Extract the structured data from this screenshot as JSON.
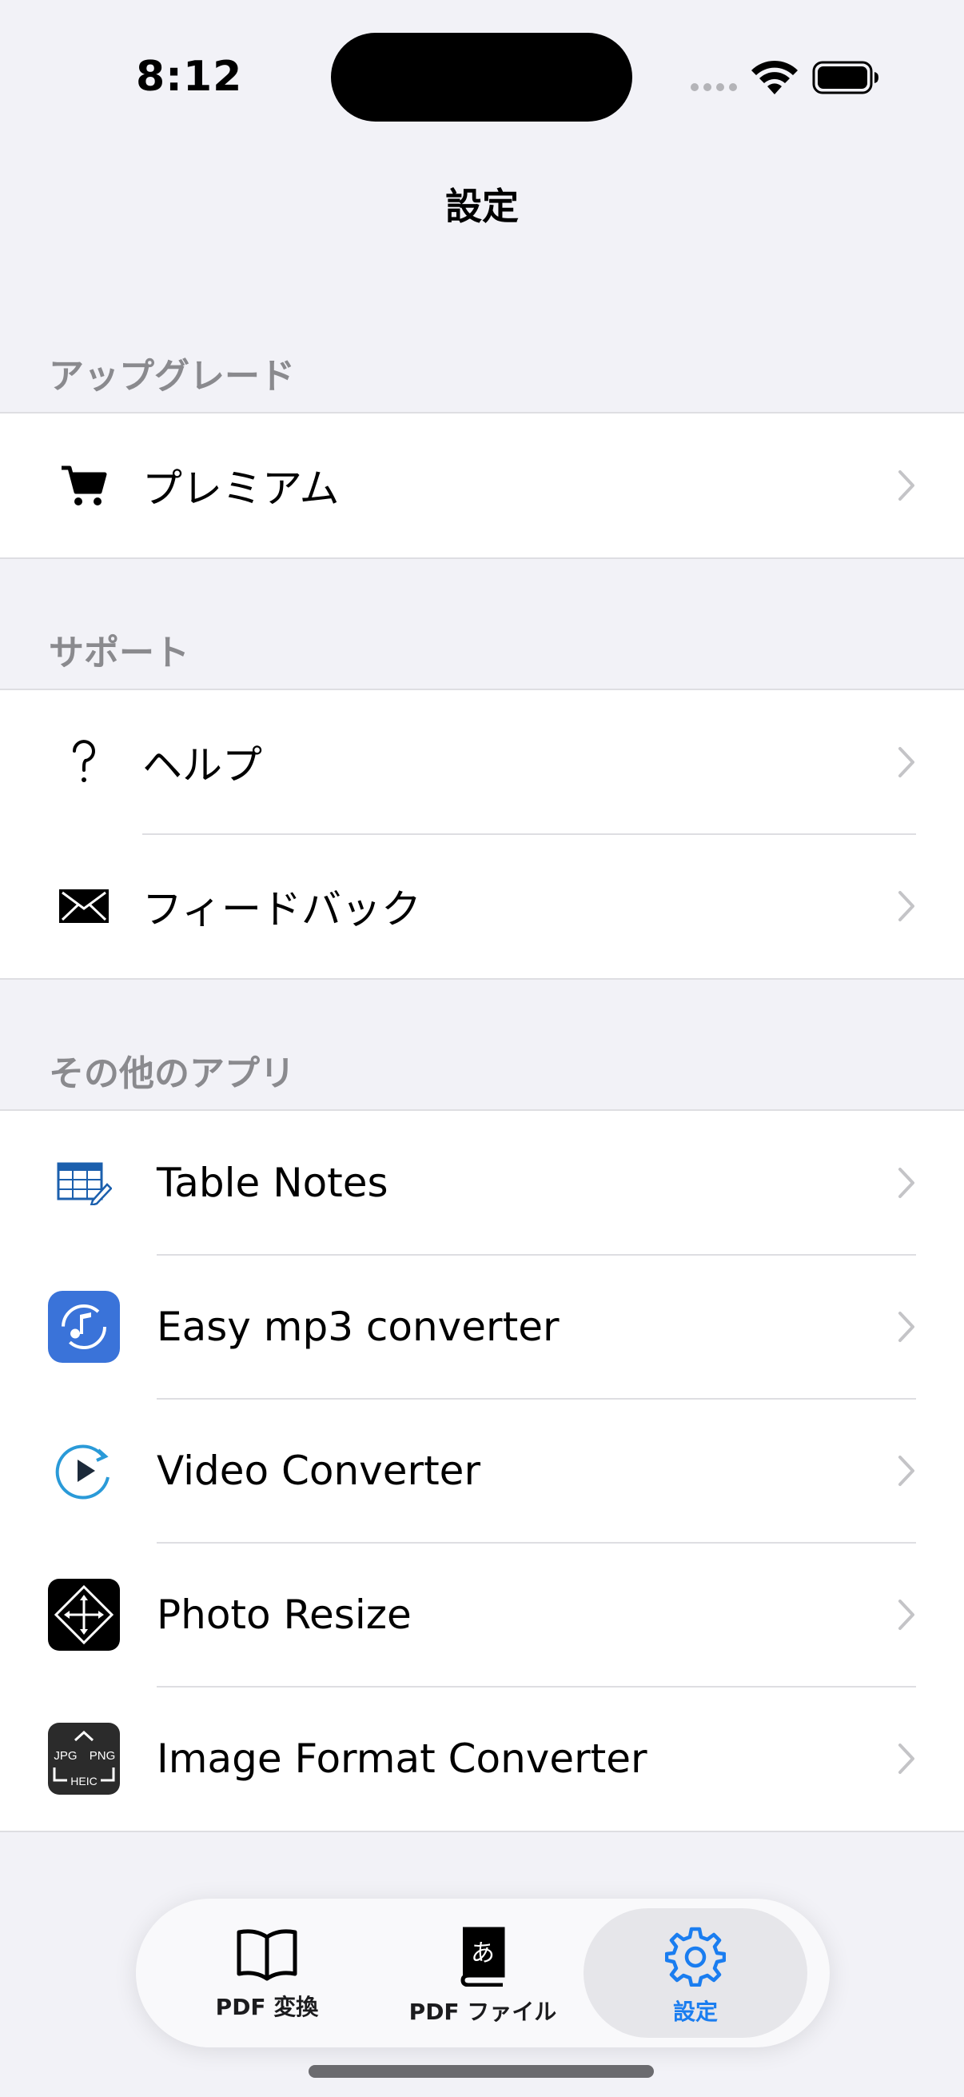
{
  "status_bar": {
    "time": "8:12"
  },
  "nav": {
    "title": "設定"
  },
  "sections": {
    "upgrade": {
      "header": "アップグレード",
      "items": [
        {
          "label": "プレミアム",
          "icon": "cart-icon"
        }
      ]
    },
    "support": {
      "header": "サポート",
      "items": [
        {
          "label": "ヘルプ",
          "icon": "question-icon"
        },
        {
          "label": "フィードバック",
          "icon": "envelope-icon"
        }
      ]
    },
    "other_apps": {
      "header": "その他のアプリ",
      "items": [
        {
          "label": "Table Notes",
          "icon": "table-notes-icon"
        },
        {
          "label": "Easy mp3 converter",
          "icon": "mp3-converter-icon"
        },
        {
          "label": "Video Converter",
          "icon": "video-converter-icon"
        },
        {
          "label": "Photo Resize",
          "icon": "photo-resize-icon"
        },
        {
          "label": "Image Format Converter",
          "icon": "image-format-converter-icon"
        }
      ]
    }
  },
  "app_icon_text": {
    "jpg": "JPG",
    "png": "PNG",
    "heic": "HEIC"
  },
  "tabbar": {
    "tabs": [
      {
        "label": "PDF 変換",
        "icon": "book-icon",
        "active": false
      },
      {
        "label": "PDF ファイル",
        "icon": "japanese-book-icon",
        "glyph": "あ",
        "active": false
      },
      {
        "label": "設定",
        "icon": "gear-icon",
        "active": true
      }
    ]
  },
  "colors": {
    "accent": "#1a7df0",
    "background": "#f2f2f7",
    "secondary_text": "#8a8a8e"
  }
}
